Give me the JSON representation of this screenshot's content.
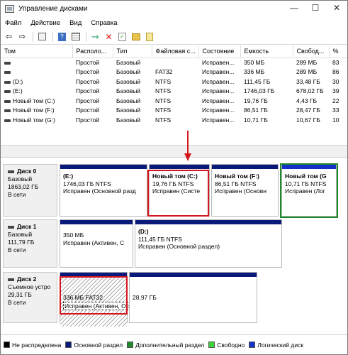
{
  "window": {
    "title": "Управление дисками",
    "minimize": "—",
    "maximize": "☐",
    "close": "✕"
  },
  "menu": [
    "Файл",
    "Действие",
    "Вид",
    "Справка"
  ],
  "table": {
    "columns": [
      "Том",
      "Располо...",
      "Тип",
      "Файловая с...",
      "Состояние",
      "Емкость",
      "Свобод...",
      "%"
    ],
    "rows": [
      [
        "",
        "Простой",
        "Базовый",
        "",
        "Исправен...",
        "350 МБ",
        "289 МБ",
        "83"
      ],
      [
        "",
        "Простой",
        "Базовый",
        "FAT32",
        "Исправен...",
        "336 МБ",
        "289 МБ",
        "86"
      ],
      [
        "(D:)",
        "Простой",
        "Базовый",
        "NTFS",
        "Исправен...",
        "111,45 ГБ",
        "33,48 ГБ",
        "30"
      ],
      [
        "(E:)",
        "Простой",
        "Базовый",
        "NTFS",
        "Исправен...",
        "1746,03 ГБ",
        "678,02 ГБ",
        "39"
      ],
      [
        "Новый том (C:)",
        "Простой",
        "Базовый",
        "NTFS",
        "Исправен...",
        "19,76 ГБ",
        "4,43 ГБ",
        "22"
      ],
      [
        "Новый том (F:)",
        "Простой",
        "Базовый",
        "NTFS",
        "Исправен...",
        "86,51 ГБ",
        "28,47 ГБ",
        "33"
      ],
      [
        "Новый том (G:)",
        "Простой",
        "Базовый",
        "NTFS",
        "Исправен...",
        "10,71 ГБ",
        "10,67 ГБ",
        "10"
      ]
    ]
  },
  "disks": {
    "d0": {
      "name": "Диск 0",
      "type": "Базовый",
      "size": "1863,02 ГБ",
      "status": "В сети",
      "parts": [
        {
          "name": "(E:)",
          "size": "1746,03 ГБ NTFS",
          "status": "Исправен (Основной разд"
        },
        {
          "name": "Новый том  (C:)",
          "size": "19,76 ГБ NTFS",
          "status": "Исправен (Систе"
        },
        {
          "name": "Новый том  (F:)",
          "size": "86,51 ГБ NTFS",
          "status": "Исправен (Основн"
        },
        {
          "name": "Новый том  (G",
          "size": "10,71 ГБ NTFS",
          "status": "Исправен (Лог"
        }
      ]
    },
    "d1": {
      "name": "Диск 1",
      "type": "Базовый",
      "size": "111,79 ГБ",
      "status": "В сети",
      "parts": [
        {
          "name": "",
          "size": "350 МБ",
          "status": "Исправен (Активен, С"
        },
        {
          "name": "(D:)",
          "size": "111,45 ГБ NTFS",
          "status": "Исправен (Основной раздел)"
        }
      ]
    },
    "d2": {
      "name": "Диск 2",
      "type": "Съемное устро",
      "size": "29,31 ГБ",
      "status": "В сети",
      "parts": [
        {
          "name": "",
          "size": "336 МБ FAT32",
          "status": "Исправен (Активен, Основной раздел)"
        },
        {
          "name": "",
          "size": "28,97 ГБ",
          "status": ""
        }
      ]
    }
  },
  "legend": [
    {
      "label": "Не распределена",
      "color": "#000000"
    },
    {
      "label": "Основной раздел",
      "color": "#0a1a7a"
    },
    {
      "label": "Дополнительный раздел",
      "color": "#1f8a2a"
    },
    {
      "label": "Свободно",
      "color": "#3ad43a"
    },
    {
      "label": "Логический диск",
      "color": "#1230c8"
    }
  ],
  "colors": {
    "highlight_red": "#d4171e",
    "highlight_green": "#1f8a2a",
    "primary_bar": "#0a1a7a"
  },
  "icons": [
    "back-icon",
    "forward-icon",
    "properties-icon",
    "help-icon",
    "list-view-icon",
    "connect-icon",
    "delete-icon",
    "check-icon",
    "open-folder-icon",
    "explore-icon"
  ]
}
